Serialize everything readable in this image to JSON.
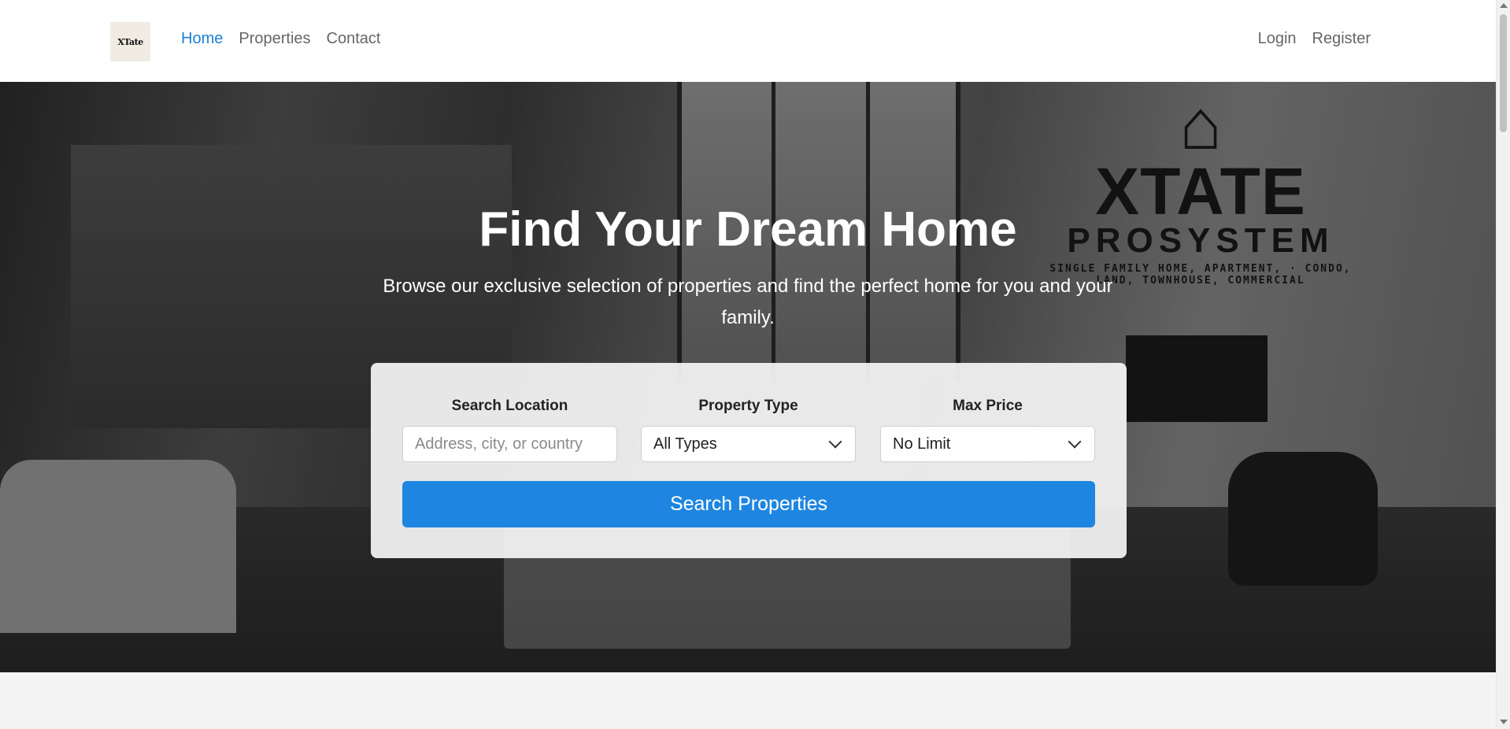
{
  "navbar": {
    "logo_text": "XTate",
    "links": [
      "Home",
      "Properties",
      "Contact"
    ],
    "active_link": "Home",
    "auth_links": [
      "Login",
      "Register"
    ],
    "accent_color": "#1e7fd6"
  },
  "hero": {
    "title": "Find Your Dream Home",
    "subtitle": "Browse our exclusive selection of properties and find the perfect home for you and your family.",
    "brand_name": "XTATE",
    "brand_sub": "PROSYSTEM",
    "brand_tag": "SINGLE FAMILY HOME, APARTMENT, · CONDO, LAND, TOWNHOUSE, COMMERCIAL"
  },
  "search": {
    "location_label": "Search Location",
    "location_placeholder": "Address, city, or country",
    "type_label": "Property Type",
    "type_value": "All Types",
    "price_label": "Max Price",
    "price_value": "No Limit",
    "button_label": "Search Properties",
    "button_color": "#1e86e0"
  },
  "icons": {
    "dropdown": "chevron-down-icon",
    "brand": "house-icon"
  }
}
